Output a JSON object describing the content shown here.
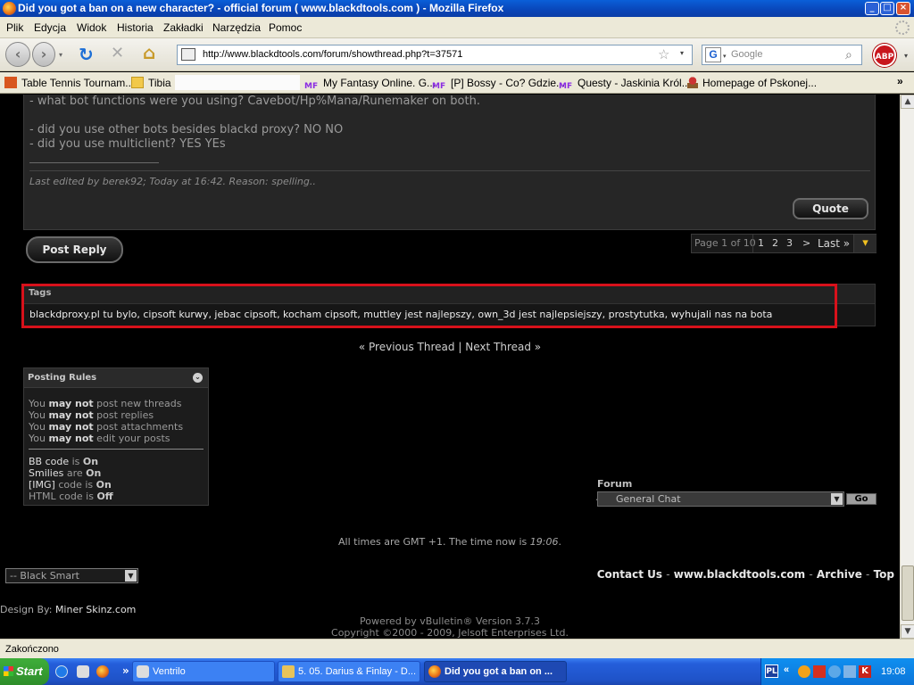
{
  "window": {
    "title": "Did you got a ban on a new character? - official forum ( www.blackdtools.com ) - Mozilla Firefox",
    "minimize_glyph": "_",
    "maximize_glyph": "□",
    "close_glyph": "×"
  },
  "menu": {
    "items": [
      "Plik",
      "Edycja",
      "Widok",
      "Historia",
      "Zakładki",
      "Narzędzia",
      "Pomoc"
    ]
  },
  "nav": {
    "back_glyph": "‹",
    "forward_glyph": "›",
    "reload_glyph": "↻",
    "stop_glyph": "✕",
    "home_glyph": "⌂",
    "url": "http://www.blackdtools.com/forum/showthread.php?t=37571",
    "search_placeholder": "Google",
    "search_engine_letter": "G",
    "abp_label": "ABP"
  },
  "bookmarks": {
    "items": [
      "Table Tennis Tournam...",
      "Tibia",
      "My Fantasy Online. G...",
      "[P] Bossy - Co? Gdzie...",
      "Questy - Jaskinia Król...",
      "Homepage of Pskonej..."
    ],
    "mf_badge": "MF",
    "overflow": "»"
  },
  "post": {
    "line1": "- what bot functions were you using? Cavebot/Hp%Mana/Runemaker on both.",
    "line2": "- did you use other bots besides blackd proxy? NO NO",
    "line3": "- did you use multiclient? YES YEs",
    "edited": "Last edited by berek92; Today at 16:42. Reason: spelling..",
    "quote_label": "Quote"
  },
  "post_reply_label": "Post Reply",
  "pagenav": {
    "label": "Page 1 of 10",
    "pages": [
      "1",
      "2",
      "3"
    ],
    "next": ">",
    "last": "Last »",
    "menu_glyph": "▾"
  },
  "tags": {
    "header": "Tags",
    "list": "blackdproxy.pl tu bylo, cipsoft kurwy, jebac cipsoft, kocham cipsoft, muttley jest najlepszy, own_3d jest najlepsiejszy, prostytutka, wyhujali nas na bota"
  },
  "thread_nav": {
    "prev": "« Previous Thread",
    "sep": "|",
    "next": "Next Thread »"
  },
  "posting_rules": {
    "header": "Posting Rules",
    "collapse_glyph": "⌄",
    "you": "You",
    "may_not": "may not",
    "rules": [
      "post new threads",
      "post replies",
      "post attachments",
      "edit your posts"
    ],
    "codes": [
      {
        "name": "BB code",
        "mid": "is",
        "state": "On"
      },
      {
        "name": "Smilies",
        "mid": "are",
        "state": "On"
      },
      {
        "name": "[IMG]",
        "mid": "code is",
        "state": "On"
      },
      {
        "name": "HTML code",
        "mid": "is",
        "state": "Off"
      }
    ]
  },
  "forum_jump": {
    "label": "Forum Jump",
    "selected": "General Chat",
    "go": "Go"
  },
  "time_info": {
    "prefix": "All times are GMT +1. The time now is",
    "time": "19:06",
    "suffix": "."
  },
  "style_select": "-- Black Smart",
  "footer": {
    "links": [
      "Contact Us",
      "www.blackdtools.com",
      "Archive",
      "Top"
    ],
    "sep": "-",
    "design_prefix": "Design By:",
    "design_link": "Miner Skinz.com",
    "powered": "Powered by vBulletin® Version 3.7.3",
    "copyright": "Copyright ©2000 - 2009, Jelsoft Enterprises Ltd."
  },
  "statusbar": "Zakończono",
  "taskbar": {
    "start": "Start",
    "buttons": [
      "Ventrilo",
      "5. 05. Darius & Finlay - D...",
      "Did you got a ban on ..."
    ],
    "lang": "PL",
    "clock": "19:08",
    "overflow": "»"
  },
  "colors": {
    "highlight_box": "#d8111b",
    "background": "#000000",
    "post_bg": "#262626",
    "taskbar": "#245edb",
    "titlebar": "#0a5fd8"
  }
}
